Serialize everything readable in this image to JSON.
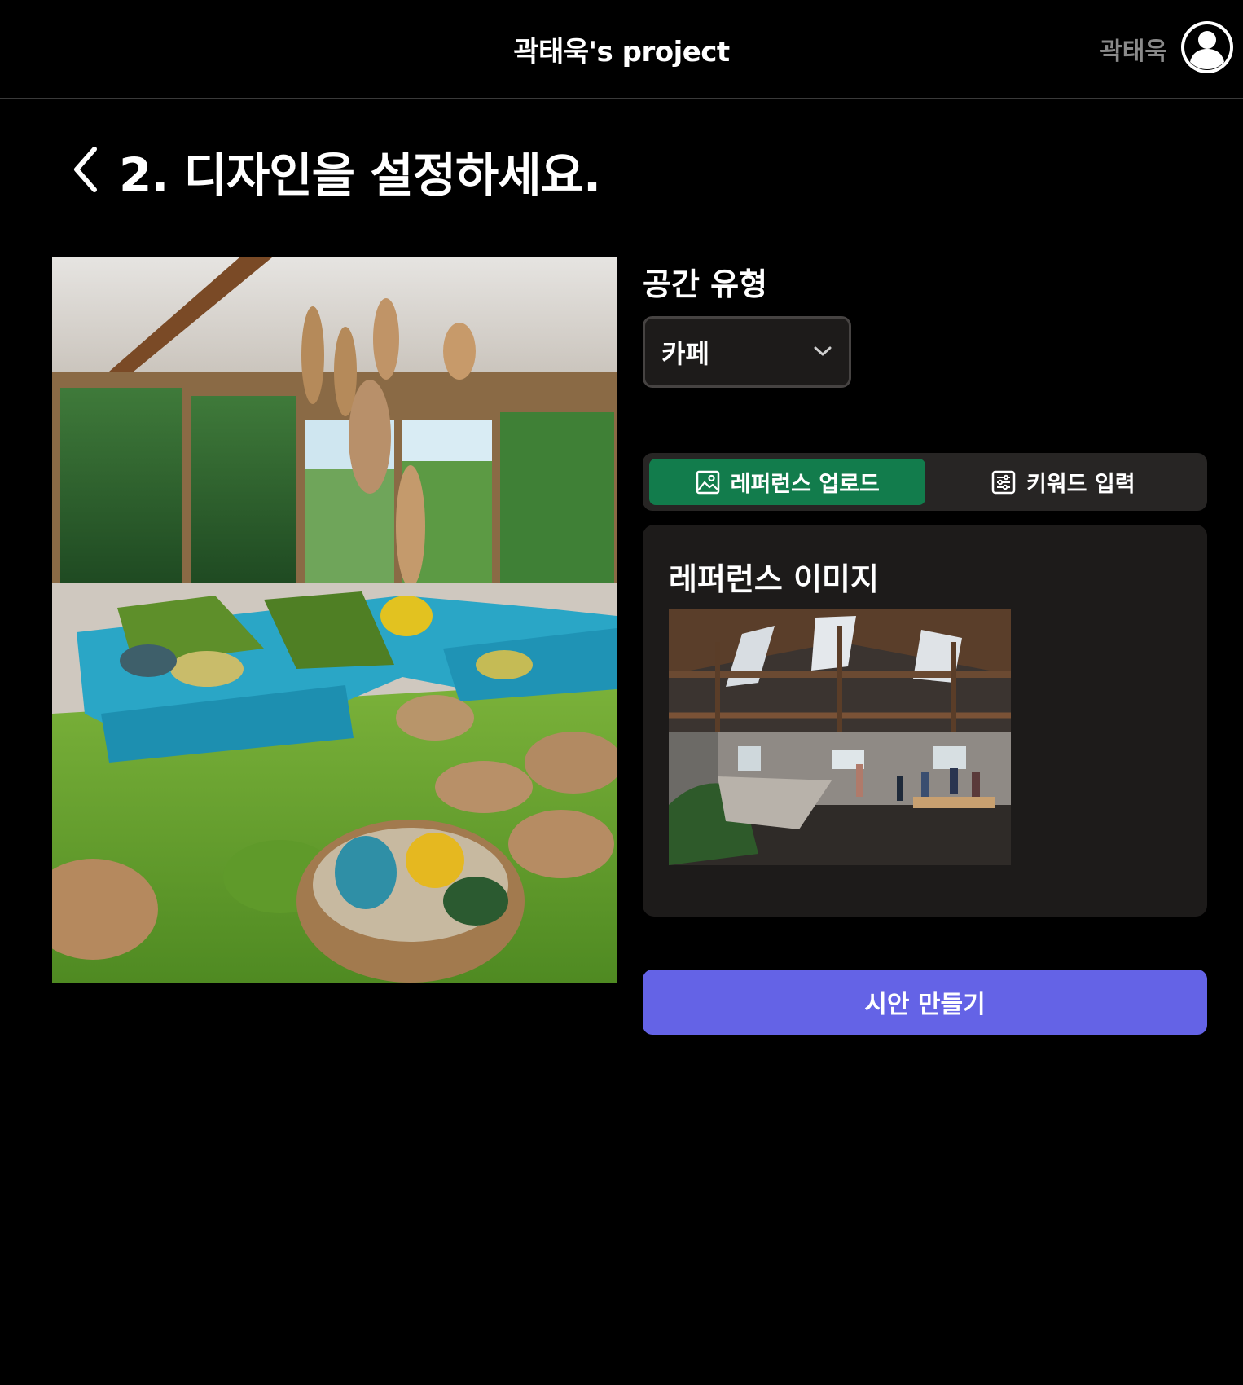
{
  "header": {
    "title": "곽태욱's project",
    "username": "곽태욱"
  },
  "page": {
    "heading": "2. 디자인을 설정하세요."
  },
  "space_type": {
    "label": "공간 유형",
    "selected": "카페"
  },
  "tabs": [
    {
      "label": "레퍼런스 업로드",
      "icon": "image-icon",
      "active": true
    },
    {
      "label": "키워드 입력",
      "icon": "sliders-icon",
      "active": false
    }
  ],
  "reference": {
    "title": "레퍼런스 이미지"
  },
  "actions": {
    "create_label": "시안 만들기"
  },
  "colors": {
    "background": "#000000",
    "tab_active": "#127c4c",
    "primary_button": "#6463e6",
    "panel": "#1d1b1a",
    "username_gray": "#8a8a8a"
  }
}
